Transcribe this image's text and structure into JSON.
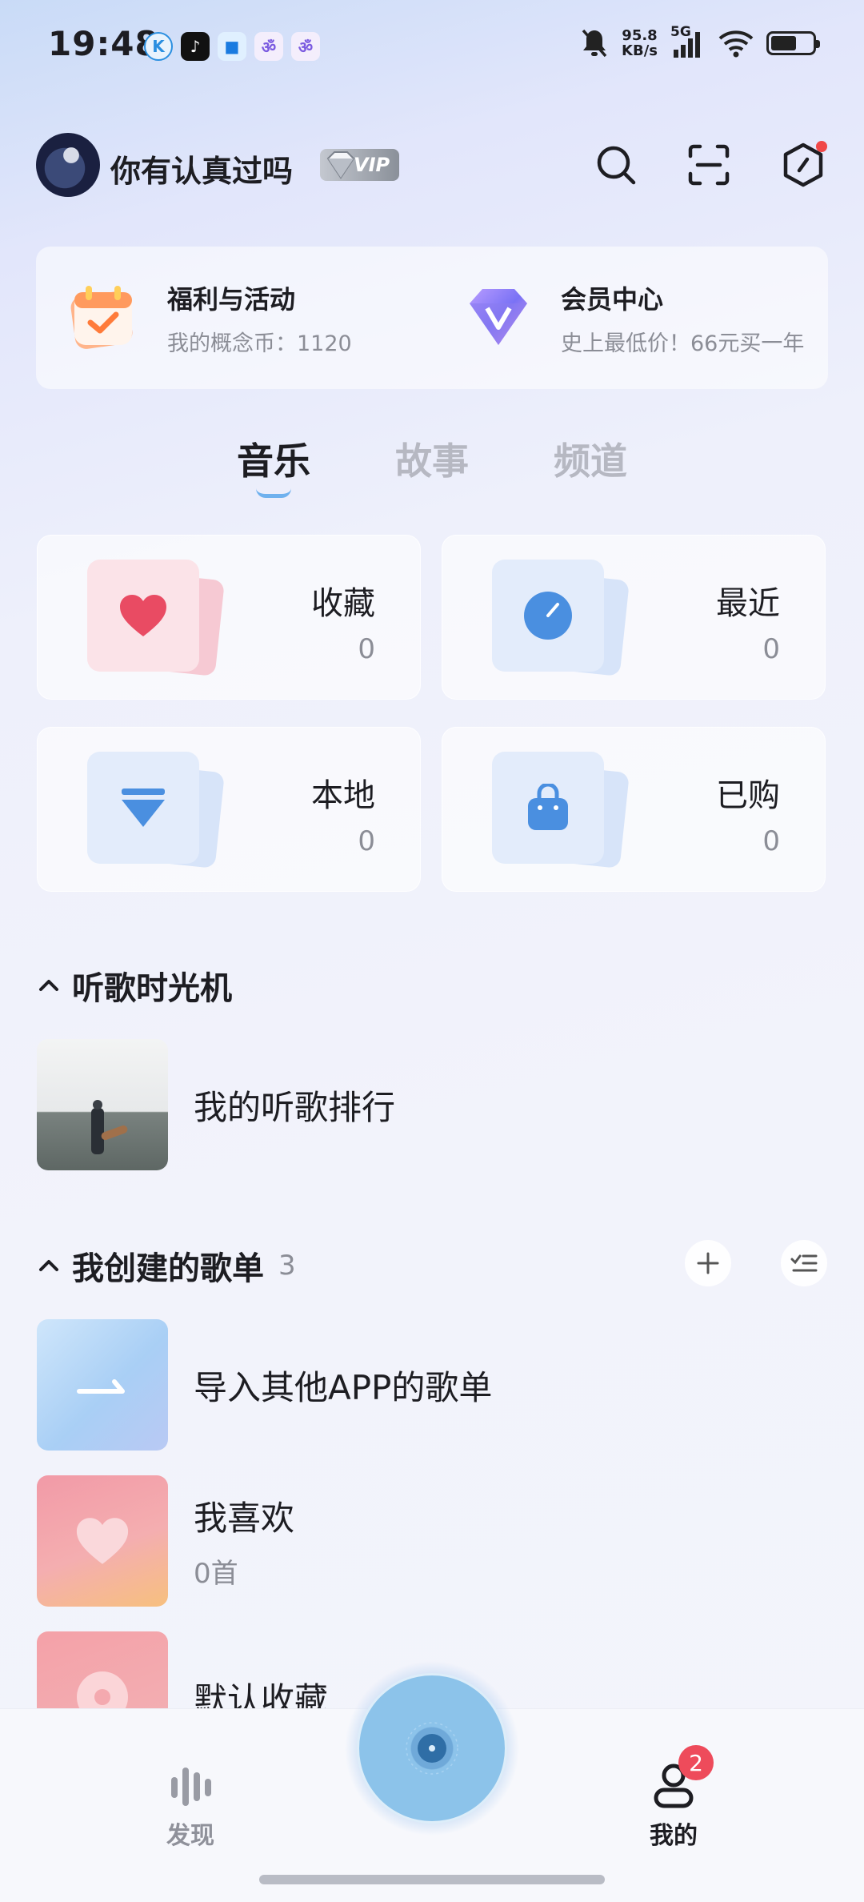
{
  "status_bar": {
    "time": "19:48",
    "notif_apps": [
      "K",
      "♪",
      "■",
      "ॐ",
      "ॐ"
    ],
    "speed_value": "95.8",
    "speed_unit": "KB/s",
    "network": "5G"
  },
  "header": {
    "username": "你有认真过吗",
    "vip_label": "VIP"
  },
  "promo": {
    "left_title": "福利与活动",
    "left_sub": "我的概念币：1120",
    "right_title": "会员中心",
    "right_sub": "史上最低价！66元买一年"
  },
  "tabs": [
    "音乐",
    "故事",
    "频道"
  ],
  "cards": [
    {
      "label": "收藏",
      "count": "0"
    },
    {
      "label": "最近",
      "count": "0"
    },
    {
      "label": "本地",
      "count": "0"
    },
    {
      "label": "已购",
      "count": "0"
    }
  ],
  "time_machine": {
    "title": "听歌时光机",
    "row_title": "我的听歌排行"
  },
  "playlists": {
    "title": "我创建的歌单",
    "count": "3",
    "items": [
      {
        "title": "导入其他APP的歌单",
        "sub": ""
      },
      {
        "title": "我喜欢",
        "sub": "0首"
      },
      {
        "title": "默认收藏",
        "sub": ""
      }
    ]
  },
  "bottom_nav": {
    "discover": "发现",
    "mine": "我的",
    "mine_badge": "2"
  },
  "colors": {
    "accent_blue": "#4a8fe0",
    "heart_red": "#e94b63",
    "badge_red": "#ee4b5b"
  }
}
